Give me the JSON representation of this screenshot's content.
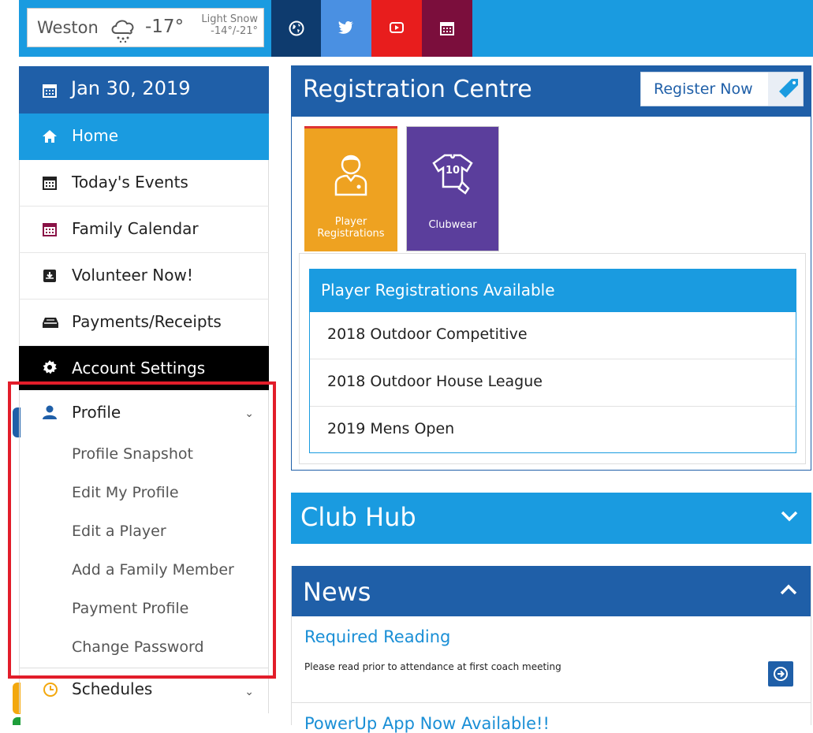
{
  "weather": {
    "city": "Weston",
    "temp": "-17°",
    "condition": "Light Snow",
    "range": "-14°/-21°"
  },
  "sidebar": {
    "date": "Jan 30, 2019",
    "items": [
      {
        "label": "Home"
      },
      {
        "label": "Today's Events"
      },
      {
        "label": "Family Calendar"
      },
      {
        "label": "Volunteer Now!"
      },
      {
        "label": "Payments/Receipts"
      },
      {
        "label": "Account Settings"
      }
    ],
    "profile": {
      "label": "Profile",
      "subitems": [
        "Profile Snapshot",
        "Edit My Profile",
        "Edit a Player",
        "Add a Family Member",
        "Payment Profile",
        "Change Password"
      ]
    },
    "schedules": "Schedules"
  },
  "registration": {
    "title": "Registration Centre",
    "register_button": "Register Now",
    "tiles": [
      {
        "label_line1": "Player",
        "label_line2": "Registrations"
      },
      {
        "label_line1": "Clubwear"
      }
    ],
    "jersey_number": "10",
    "available_title": "Player Registrations Available",
    "available": [
      "2018 Outdoor Competitive",
      "2018 Outdoor House League",
      "2019 Mens Open"
    ]
  },
  "club_hub": {
    "title": "Club Hub"
  },
  "news": {
    "title": "News",
    "items": [
      {
        "title": "Required Reading",
        "desc": "Please read prior to attendance at first coach meeting"
      },
      {
        "title": "PowerUp App Now Available!!"
      }
    ]
  },
  "colors": {
    "primary_dark": "#1f5fa8",
    "primary_light": "#1a9be0",
    "highlight": "#e21d2a",
    "player_tile": "#eea221",
    "clubwear_tile": "#5b3e9c"
  }
}
